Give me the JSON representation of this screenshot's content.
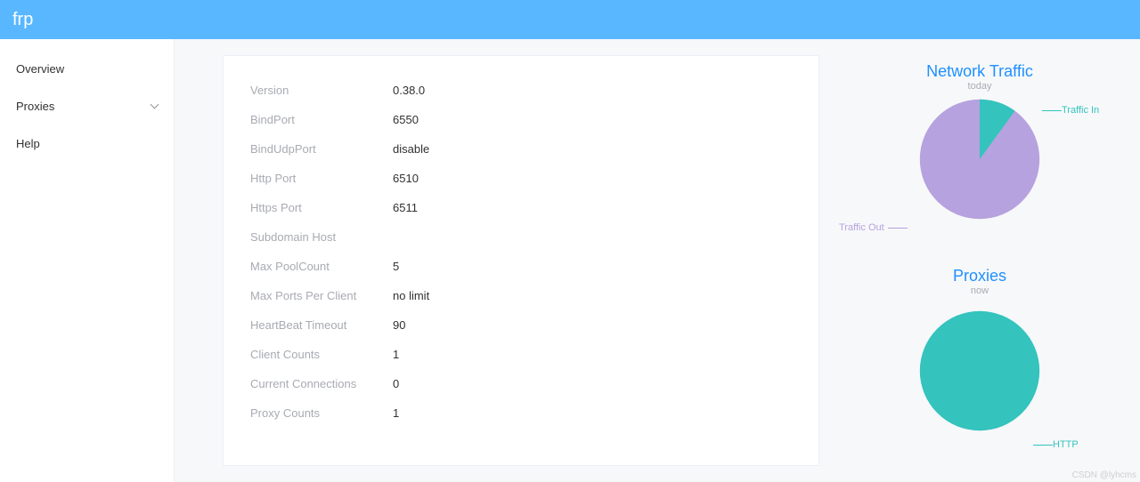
{
  "header": {
    "title": "frp"
  },
  "sidebar": {
    "items": [
      {
        "label": "Overview",
        "has_children": false
      },
      {
        "label": "Proxies",
        "has_children": true
      },
      {
        "label": "Help",
        "has_children": false
      }
    ]
  },
  "overview": {
    "rows": [
      {
        "label": "Version",
        "value": "0.38.0"
      },
      {
        "label": "BindPort",
        "value": "6550"
      },
      {
        "label": "BindUdpPort",
        "value": "disable"
      },
      {
        "label": "Http Port",
        "value": "6510"
      },
      {
        "label": "Https Port",
        "value": "6511"
      },
      {
        "label": "Subdomain Host",
        "value": ""
      },
      {
        "label": "Max PoolCount",
        "value": "5"
      },
      {
        "label": "Max Ports Per Client",
        "value": "no limit"
      },
      {
        "label": "HeartBeat Timeout",
        "value": "90"
      },
      {
        "label": "Client Counts",
        "value": "1"
      },
      {
        "label": "Current Connections",
        "value": "0"
      },
      {
        "label": "Proxy Counts",
        "value": "1"
      }
    ]
  },
  "charts": {
    "traffic": {
      "title": "Network Traffic",
      "subtitle": "today",
      "labels": {
        "in": "Traffic In",
        "out": "Traffic Out"
      },
      "colors": {
        "in": "#34c3bd",
        "out": "#b6a2de"
      }
    },
    "proxies": {
      "title": "Proxies",
      "subtitle": "now",
      "labels": {
        "single": "HTTP"
      },
      "colors": {
        "single": "#34c3bd"
      }
    }
  },
  "chart_data": [
    {
      "type": "pie",
      "title": "Network Traffic",
      "subtitle": "today",
      "series": [
        {
          "name": "Traffic In",
          "value": 8,
          "color": "#34c3bd"
        },
        {
          "name": "Traffic Out",
          "value": 92,
          "color": "#b6a2de"
        }
      ]
    },
    {
      "type": "pie",
      "title": "Proxies",
      "subtitle": "now",
      "series": [
        {
          "name": "HTTP",
          "value": 100,
          "color": "#34c3bd"
        }
      ]
    }
  ],
  "watermark": "CSDN @lyhcms"
}
